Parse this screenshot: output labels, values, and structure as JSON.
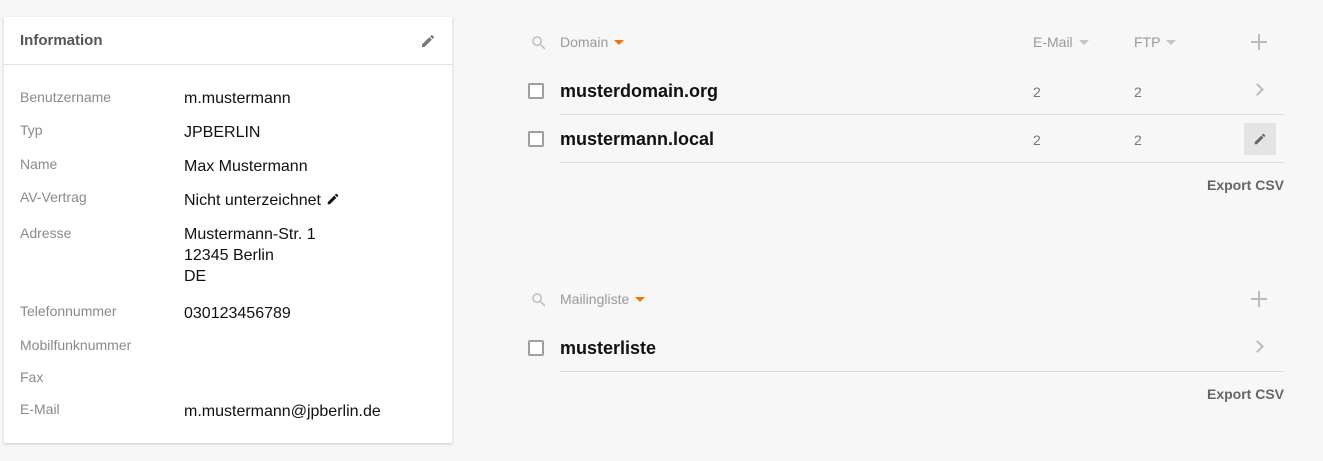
{
  "info": {
    "title": "Information",
    "fields": [
      {
        "label": "Benutzername",
        "value": "m.mustermann"
      },
      {
        "label": "Typ",
        "value": "JPBERLIN"
      },
      {
        "label": "Name",
        "value": "Max Mustermann"
      },
      {
        "label": "AV-Vertrag",
        "value": "Nicht unterzeichnet"
      },
      {
        "label": "Adresse",
        "lines": [
          "Mustermann-Str. 1",
          "12345 Berlin",
          "DE"
        ]
      },
      {
        "label": "Telefonnummer",
        "value": "030123456789"
      },
      {
        "label": "Mobilfunknummer",
        "value": ""
      },
      {
        "label": "Fax",
        "value": ""
      },
      {
        "label": "E-Mail",
        "value": "m.mustermann@jpberlin.de"
      }
    ]
  },
  "domains": {
    "columns": {
      "name": "Domain",
      "email": "E-Mail",
      "ftp": "FTP"
    },
    "rows": [
      {
        "name": "musterdomain.org",
        "email": "2",
        "ftp": "2"
      },
      {
        "name": "mustermann.local",
        "email": "2",
        "ftp": "2"
      }
    ],
    "export_label": "Export CSV"
  },
  "mailinglists": {
    "columns": {
      "name": "Mailingliste"
    },
    "rows": [
      {
        "name": "musterliste"
      }
    ],
    "export_label": "Export CSV"
  },
  "colors": {
    "accent": "#f07800",
    "muted": "#9a9a9a"
  },
  "icons": {
    "card_edit": "pencil-icon",
    "search": "search-icon",
    "add": "plus-icon",
    "row_open": "chevron-right-icon"
  }
}
